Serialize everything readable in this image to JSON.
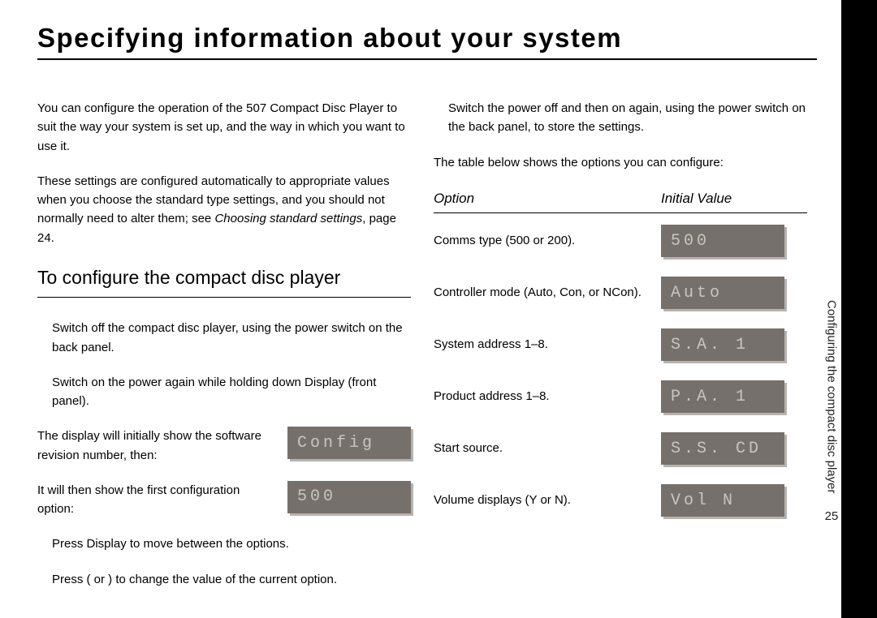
{
  "title": "Specifying information about your system",
  "left": {
    "p1": "You can configure the operation of the 507 Compact Disc Player to suit the way your system is set up, and the way in which you want to use it.",
    "p2a": "These settings are configured automatically to appropriate values when you choose the standard type settings, and you should not normally need to alter them; see ",
    "p2b_em": "Choosing standard settings",
    "p2c": ", page 24.",
    "subtitle": "To configure the compact disc player",
    "step1": "Switch off the compact disc player, using the power switch on the back panel.",
    "step2": "Switch on the power again while holding down  Display  (front panel).",
    "row1_text": "The display will initially show the software revision number, then:",
    "row1_lcd": "Config",
    "row2_text": "It will then show the first configuration option:",
    "row2_lcd": "500",
    "step3": "Press Display  to move between the options.",
    "step4": "Press (  or  )  to change the value of the current option."
  },
  "right": {
    "p1": "Switch the power off and then on again, using the power switch on the back panel, to store the settings.",
    "p2": "The table below shows the options you can configure:",
    "head_option": "Option",
    "head_value": "Initial Value",
    "rows": [
      {
        "opt": "Comms type (500 or 200).",
        "lcd": "500"
      },
      {
        "opt": "Controller mode (Auto, Con, or NCon).",
        "lcd": "Auto"
      },
      {
        "opt": "System address 1–8.",
        "lcd": "S.A. 1"
      },
      {
        "opt": "Product address 1–8.",
        "lcd": "P.A. 1"
      },
      {
        "opt": "Start source.",
        "lcd": "S.S. CD"
      },
      {
        "opt": "Volume displays (Y or N).",
        "lcd": "Vol N"
      }
    ]
  },
  "side": {
    "label": "Configuring the compact disc player",
    "page": "25"
  }
}
